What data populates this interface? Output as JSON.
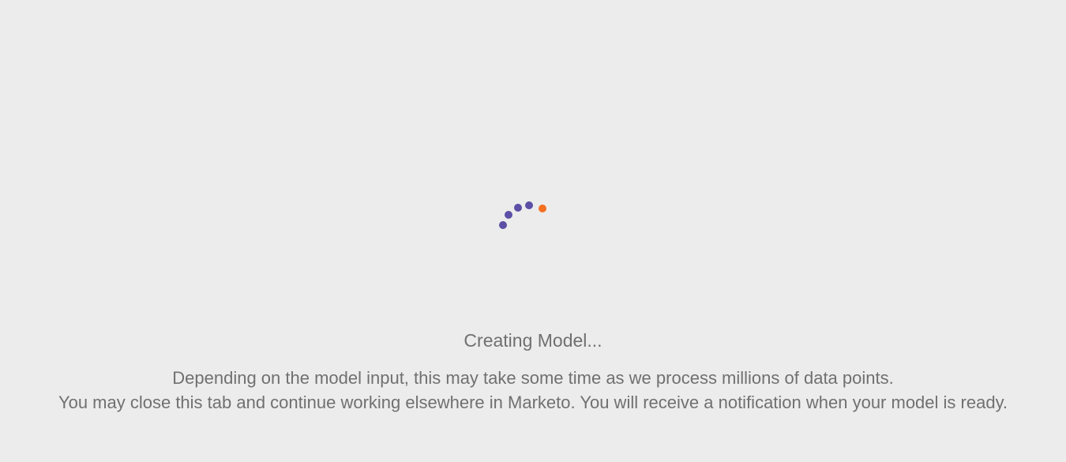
{
  "loading": {
    "title": "Creating Model...",
    "message_lines": [
      "Depending on the model input, this may take some time as we process millions of data points.",
      "You may close this tab and continue working elsewhere in Marketo. You will receive a notification when your model is ready."
    ]
  },
  "spinner": {
    "icon": "loading-dots-icon",
    "primary_color": "#5b4fa6",
    "accent_color": "#f37021"
  }
}
